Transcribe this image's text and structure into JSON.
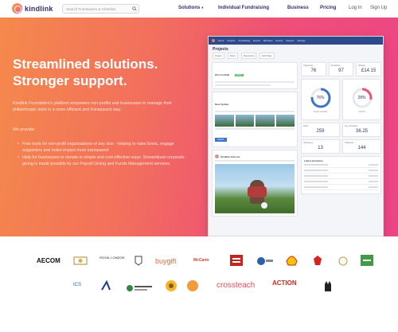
{
  "nav": {
    "brand": "kindlink",
    "search_placeholder": "Search Fundraisers & Charities",
    "links": [
      {
        "label": "Solutions",
        "caret": "▼"
      },
      {
        "label": "Individual Fundraising"
      },
      {
        "label": "Business"
      },
      {
        "label": "Pricing"
      },
      {
        "label": "Log In"
      },
      {
        "label": "Sign Up"
      }
    ]
  },
  "hero": {
    "headline_line1": "Streamlined solutions.",
    "headline_line2": "Stronger support.",
    "intro": "Kindlink Foundation's platform empowers non-profits and businesses to manage their philanthropic work in a more efficient and transparent way.",
    "provide_label": "We provide:",
    "bullets": [
      "Free tools for non-profit organisations of any size - helping to raise funds, engage supporters and make impact more transparent",
      "Help for businesses to donate in simple and cost effective ways. Streamlined corporate giving is made possible by our Payroll Giving and Funds Management services."
    ]
  },
  "dashboard": {
    "title": "Projects",
    "bar_tabs": [
      "Home",
      "Projects",
      "Fundraising",
      "Events",
      "Members",
      "Donors",
      "Reports",
      "Settings"
    ],
    "sub_tabs": [
      "Project",
      "Posts",
      "Supporters",
      "Edit Page"
    ],
    "left": {
      "status_label": "Kits Football",
      "status_tag": "Active",
      "post_label": "New Update",
      "publish_label": "Publish",
      "author_label": "Kindlink Schools"
    },
    "stats_top": [
      {
        "label": "Supporters",
        "value": "76"
      },
      {
        "label": "Donations",
        "value": "97"
      },
      {
        "label": "Raised",
        "value": "£14.15"
      }
    ],
    "rings": [
      {
        "value": "76%",
        "caption": "Target reached",
        "fraction": 0.76,
        "color": "#3c74c7"
      },
      {
        "value": "28%",
        "caption": "Gift Aid",
        "fraction": 0.28,
        "color": "#ee4f77"
      }
    ],
    "stats_mid": [
      {
        "label": "Posts",
        "value": "259"
      },
      {
        "label": "Avg. Donation",
        "value": "36.25"
      }
    ],
    "stats_low": [
      {
        "label": "Volunteers",
        "value": "13"
      },
      {
        "label": "Followers",
        "value": "144"
      }
    ],
    "table_label": "Latest donations"
  },
  "logos": {
    "row1": [
      "AECOM",
      "",
      "ROYAL LONDON",
      "",
      "buygift",
      "McCann",
      "",
      "",
      "Shell",
      "",
      "",
      ""
    ],
    "row2": [
      "ICS",
      "",
      "",
      "",
      "",
      "crossteach",
      "ACTION",
      ""
    ]
  },
  "colors": {
    "hero_start": "#f5894c",
    "hero_end": "#ec4585",
    "brand_navy": "#3b2a6a",
    "accent_blue": "#3c74c7"
  }
}
